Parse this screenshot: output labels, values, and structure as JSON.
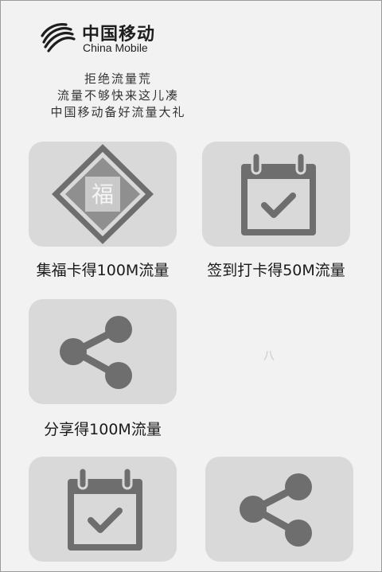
{
  "brand": {
    "name_cn": "中国移动",
    "name_en": "China Mobile"
  },
  "slogan": [
    "拒绝流量荒",
    "流量不够快来这儿凑",
    "中国移动备好流量大礼"
  ],
  "tiles": [
    {
      "label": "集福卡得100M流量",
      "icon": "fu-card-icon",
      "fu_char": "福"
    },
    {
      "label": "签到打卡得50M流量",
      "icon": "calendar-check-icon"
    },
    {
      "label": "分享得100M流量",
      "icon": "share-icon"
    },
    {
      "label": "",
      "icon": "calendar-check-icon"
    },
    {
      "label": "",
      "icon": "share-icon"
    }
  ],
  "ghost_text": "八",
  "colors": {
    "tile_bg": "#d9d9d9",
    "icon_gray": "#6e6e6e",
    "page_bg": "#f2f2f2"
  }
}
